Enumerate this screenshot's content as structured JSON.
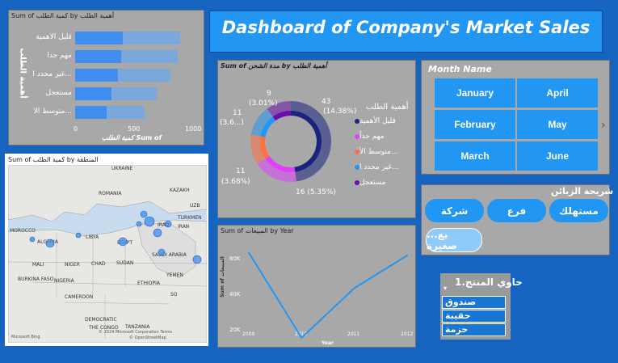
{
  "header": {
    "title": "Dashboard of  Company's Market Sales"
  },
  "bar_panel": {
    "title": "Sum of كمية الطلب by أهمية الطلب",
    "ylabel": "أهمية الطلب",
    "xlabel": "كمية الطلب Sum of",
    "ticks": [
      "0",
      "500",
      "1000"
    ]
  },
  "map_panel": {
    "title": "Sum of كمية الطلب by المنطقة",
    "labels": {
      "ukraine": "UKRAINE",
      "romania": "ROMANIA",
      "kazakh": "KAZAKH",
      "uzb": "UZB",
      "turkmen": "TURKMEN",
      "morocco": "MOROCCO",
      "algeria": "ALGERIA",
      "libya": "LIBYA",
      "egypt": "EGYPT",
      "iran": "IRAN",
      "iraq": "IRAQ",
      "saudi": "SAUDI ARABIA",
      "yemen": "YEMEN",
      "mali": "MALI",
      "niger": "NIGER",
      "chad": "CHAD",
      "sudan": "SUDAN",
      "burkina": "BURKINA FASO",
      "nigeria": "NIGERIA",
      "ethiopia": "ETHIOPIA",
      "cameroon": "CAMEROON",
      "so": "SO",
      "drc": "DEMOCRATIC",
      "congo": "THE CONGO",
      "tanzania": "TANZANIA"
    },
    "credit": "Microsoft Bing",
    "copyright": "© 2024 Microsoft Corporation  Terms",
    "copyright2": "© OpenStreetMap"
  },
  "donut_panel": {
    "title": "Sum of مدة الشحن by أهمية الطلب",
    "legend_title": "أهمية الطلب",
    "labels": {
      "l43": "43",
      "l43p": "(14.38%)",
      "l9": "9",
      "l9p": "(3.01%)",
      "l11a": "11",
      "l11ap": "(3.6...)",
      "l11b": "11",
      "l11bp": "(3.68%)",
      "l16": "16 (5.35%)"
    }
  },
  "line_panel": {
    "title": "Sum of المبيعات by Year",
    "ylabel": "Sum of المبيعات",
    "xlabel": "Year",
    "yticks": [
      "60K",
      "40K",
      "20K"
    ],
    "xticks": [
      "2009",
      "2010",
      "2011",
      "2012"
    ]
  },
  "month_slicer": {
    "title": "Month Name",
    "months": [
      "January",
      "April",
      "February",
      "May",
      "March",
      "June"
    ]
  },
  "customer_slicer": {
    "title": "شريحة الزبائن",
    "options": [
      "مستهلك",
      "فرع",
      "شركة",
      "...يع صغيرة"
    ]
  },
  "container_slicer": {
    "title": "حاوي المنتج.1",
    "items": [
      "صندوق",
      "حقيبة",
      "حزمة"
    ]
  },
  "colors": {
    "blue": "#1565c0",
    "tile": "#2196f3",
    "panel": "#a8a8a8"
  },
  "chart_data": [
    {
      "type": "bar",
      "title": "Sum of كمية الطلب by أهمية الطلب",
      "categories": [
        "قليل الأهمية",
        "مهم جداً",
        "غير محدد ا...",
        "مستعجل",
        "متوسط الأ..."
      ],
      "values": [
        880,
        860,
        800,
        680,
        580
      ],
      "xlim": [
        0,
        1000
      ]
    },
    {
      "type": "pie",
      "title": "Sum of مدة الشحن by أهمية الطلب",
      "categories": [
        "قليل الأهمية",
        "مهم جداً",
        "متوسط الأ...",
        "غير محدد ا...",
        "مستعجل"
      ],
      "values": [
        43,
        16,
        11,
        11,
        9
      ],
      "colors": [
        "#1a237e",
        "#e040fb",
        "#ff7043",
        "#2196f3",
        "#6a0dad"
      ]
    },
    {
      "type": "line",
      "title": "Sum of المبيعات by Year",
      "x": [
        "2009",
        "2010",
        "2011",
        "2012"
      ],
      "series": [
        {
          "values": [
            70000,
            10000,
            45000,
            68000
          ]
        }
      ],
      "ylim": [
        0,
        75000
      ]
    }
  ]
}
